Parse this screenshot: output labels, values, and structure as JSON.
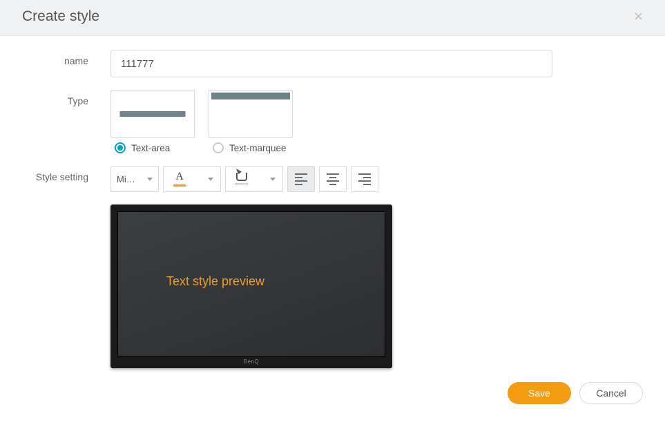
{
  "header": {
    "title": "Create style"
  },
  "form": {
    "name_label": "name",
    "name_value": "111777",
    "type_label": "Type",
    "type_options": {
      "text_area": "Text-area",
      "text_marquee": "Text-marquee",
      "selected": "text_area"
    },
    "style_label": "Style setting"
  },
  "toolbar": {
    "font_selected": "Mi…",
    "text_color": "#f39c12",
    "fill_color": "#ffffff",
    "align_selected": "left"
  },
  "preview": {
    "text": "Text style preview",
    "brand": "BenQ"
  },
  "footer": {
    "save": "Save",
    "cancel": "Cancel"
  }
}
